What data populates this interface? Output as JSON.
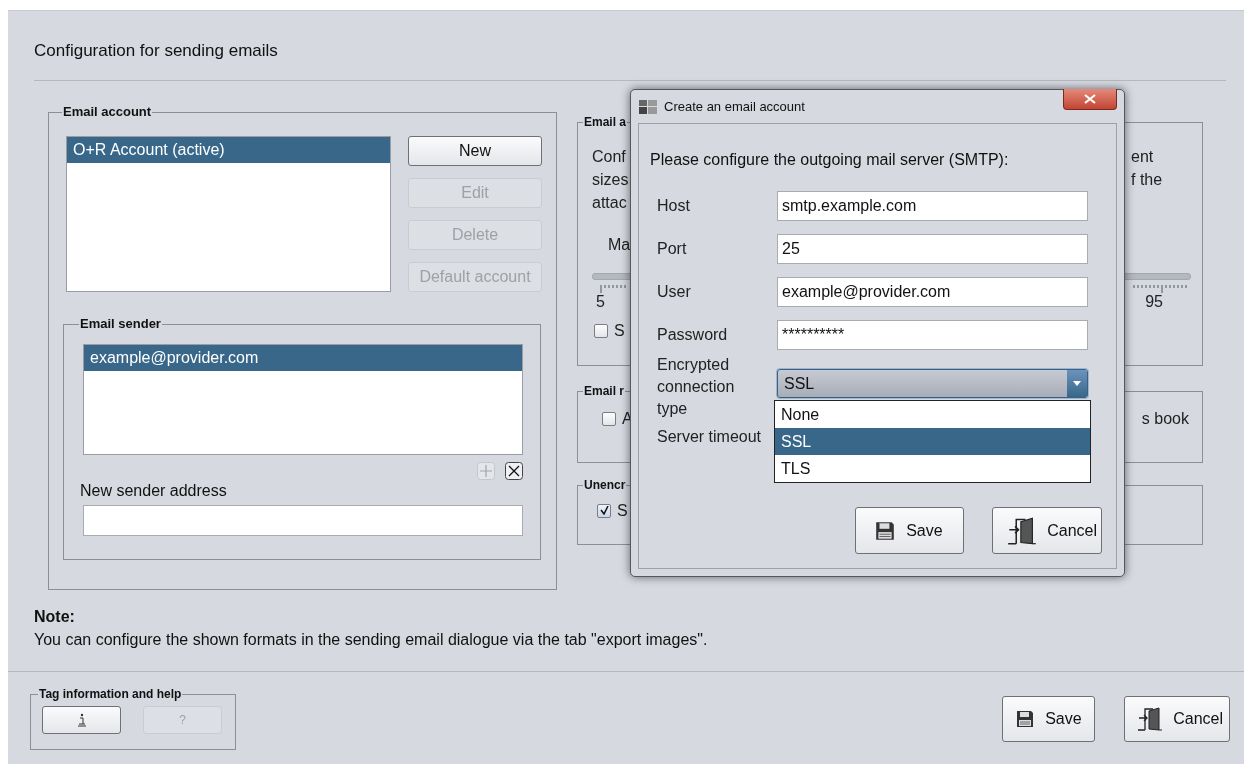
{
  "title": "Configuration for sending emails",
  "email_account": {
    "legend": "Email account",
    "accounts": [
      {
        "name": "O+R Account (active)",
        "selected": true
      }
    ],
    "buttons": [
      {
        "label": "New",
        "disabled": false
      },
      {
        "label": "Edit",
        "disabled": true
      },
      {
        "label": "Delete",
        "disabled": true
      },
      {
        "label": "Default account",
        "disabled": true
      }
    ]
  },
  "email_sender": {
    "legend": "Email sender",
    "senders": [
      {
        "address": "example@provider.com",
        "selected": true
      }
    ],
    "add_button": {
      "disabled": true
    },
    "remove_button": {
      "disabled": false
    },
    "new_sender_label": "New sender address"
  },
  "attachments": {
    "legend": "Email a",
    "text_left": [
      "Conf",
      "sizes",
      "attac"
    ],
    "text_right": [
      "ent",
      "f the"
    ],
    "slider_label": "Ma",
    "min_label": "5",
    "max_label": "95",
    "checkbox": {
      "label": "S",
      "checked": false
    }
  },
  "recipients": {
    "legend": "Email r",
    "checkbox": {
      "label": "A",
      "checked": false
    },
    "text_right": "s book"
  },
  "unencrypted": {
    "legend": "Unencr",
    "checkbox": {
      "label": "S",
      "checked": true
    }
  },
  "note": {
    "heading": "Note:",
    "text": "You can configure the shown formats in the sending email dialogue via the tab \"export images\"."
  },
  "tag_help": {
    "legend": "Tag information and help",
    "buttons": [
      {
        "kind": "info",
        "disabled": false
      },
      {
        "kind": "help",
        "label": "?",
        "disabled": true
      }
    ]
  },
  "footer_buttons": [
    {
      "kind": "save",
      "label": "Save"
    },
    {
      "kind": "cancel",
      "label": "Cancel"
    }
  ],
  "dialog": {
    "title": "Create an email account",
    "prompt": "Please configure the outgoing mail server (SMTP):",
    "fields": [
      {
        "label": "Host",
        "value": "smtp.example.com"
      },
      {
        "label": "Port",
        "value": "25"
      },
      {
        "label": "User",
        "value": "example@provider.com"
      },
      {
        "label": "Password",
        "value": "**********"
      }
    ],
    "encryption": {
      "label": "Encrypted connection type",
      "value": "SSL",
      "expanded": true,
      "options": [
        {
          "label": "None",
          "selected": false
        },
        {
          "label": "SSL",
          "selected": true
        },
        {
          "label": "TLS",
          "selected": false
        }
      ]
    },
    "timeout": {
      "label": "Server timeout"
    },
    "buttons": [
      {
        "kind": "save",
        "label": "Save"
      },
      {
        "kind": "cancel",
        "label": "Cancel"
      }
    ]
  }
}
